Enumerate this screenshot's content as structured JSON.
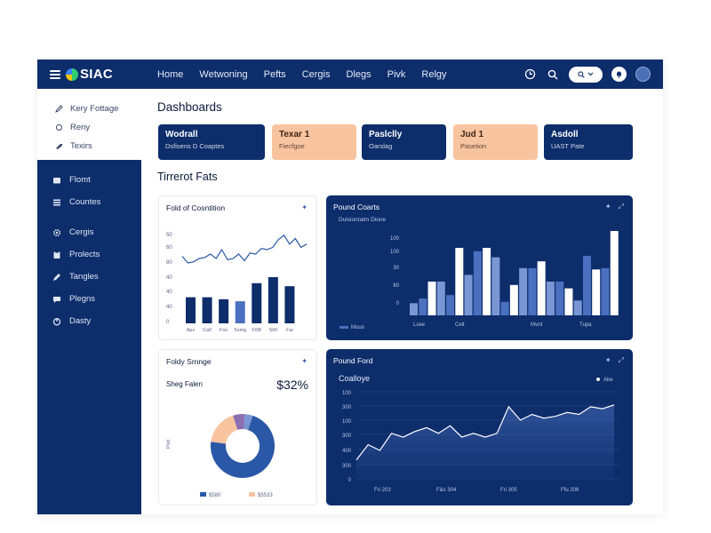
{
  "app": {
    "logo": "SIAC"
  },
  "nav": [
    "Home",
    "Wetwoning",
    "Pefts",
    "Cergis",
    "Dlegs",
    "Pivk",
    "Relgy"
  ],
  "sidebar": {
    "top_items": [
      "Kery Fottage",
      "Reny",
      "Texirs"
    ],
    "group1": [
      "Flomt",
      "Countes"
    ],
    "group2": [
      "Cergis",
      "Prolects",
      "Tangles",
      "Plegns",
      "Dasty"
    ]
  },
  "page": {
    "title": "Dashboards",
    "section_title": "Tirrerot Fats"
  },
  "kpis": [
    {
      "title": "Wodrall",
      "sub": "Dsfisens D Coaptes",
      "style": "dark"
    },
    {
      "title": "Texar 1",
      "sub": "Fiecfgoe",
      "style": "peach"
    },
    {
      "title": "Paslclly",
      "sub": "Oarslag",
      "style": "dark"
    },
    {
      "title": "Jud 1",
      "sub": "Pasetion",
      "style": "peach"
    },
    {
      "title": "Asdoll",
      "sub": "UAST Pate",
      "style": "dark"
    }
  ],
  "cards": {
    "fold": {
      "title": "Fold of Cosntition"
    },
    "pound": {
      "title": "Pound Coarts",
      "sub": "Duisiontatm Dione",
      "legend": "Mouo"
    },
    "fold2": {
      "title": "Foldy Srnnge",
      "summary_label": "Sheg Falen",
      "summary_value": "$32%",
      "axis_label": "Pivd",
      "legend": [
        "$580",
        "$5533"
      ]
    },
    "pound2": {
      "title": "Pound Ford",
      "subtitle": "Coalloye",
      "legend": "Abe"
    }
  },
  "colors": {
    "navy": "#0d2d6b",
    "accent_blue": "#2b58a6",
    "mid_blue": "#4a70bf",
    "light_blue": "#7a96d4",
    "peach": "#f8c4a0",
    "purple": "#8b6fb0"
  },
  "chart_data": [
    {
      "type": "line",
      "title": "Fold of Cosntition",
      "yticks": [
        "50",
        "60",
        "80",
        "40",
        "40",
        "40",
        "0"
      ],
      "x": [
        1,
        2,
        3,
        4,
        5,
        6,
        7,
        8,
        9,
        10,
        11,
        12,
        13,
        14,
        15,
        16,
        17,
        18,
        19,
        20,
        21,
        22,
        23
      ],
      "values": [
        50,
        44,
        45,
        48,
        49,
        52,
        48,
        56,
        47,
        48,
        52,
        46,
        53,
        52,
        57,
        56,
        58,
        65,
        69,
        61,
        66,
        58,
        61
      ],
      "ylim": [
        0,
        80
      ]
    },
    {
      "type": "bar",
      "categories": [
        "Apx",
        "Ca0",
        "Fxo",
        "Ssmg",
        "Fi98",
        "Slt0",
        "Fai"
      ],
      "values": [
        26,
        26,
        24,
        22,
        40,
        46,
        37
      ],
      "highlight_series": [
        0,
        0,
        0,
        22,
        0,
        0,
        0
      ],
      "ylim": [
        0,
        80
      ]
    },
    {
      "type": "bar",
      "title": "Pound Coarts",
      "yticks": [
        "100",
        "100",
        "30",
        "80",
        "0"
      ],
      "categories": [
        "Lsee",
        "Celt",
        "Mvrd",
        "Tupa"
      ],
      "series": [
        {
          "values": [
            18,
            50,
            60,
            86,
            70,
            50,
            22
          ]
        },
        {
          "values": [
            25,
            30,
            95,
            20,
            70,
            50,
            88,
            70
          ]
        },
        {
          "values": [
            50,
            100,
            100,
            45,
            80,
            40,
            68,
            125
          ]
        }
      ],
      "ylim": [
        0,
        140
      ]
    },
    {
      "type": "pie",
      "title": "Foldy Srnnge",
      "slices": [
        {
          "label": "$580",
          "value": 72
        },
        {
          "label": "$5533",
          "value": 18
        },
        {
          "value": 6
        },
        {
          "value": 4
        }
      ]
    },
    {
      "type": "area",
      "title": "Pound Ford",
      "yticks": [
        "100",
        "300",
        "100",
        "300",
        "400",
        "300",
        "0"
      ],
      "xticks": [
        "Fri 203",
        "F&s 304",
        "Fri 305",
        "Ffu 206"
      ],
      "x": [
        1,
        2,
        3,
        4,
        5,
        6,
        7,
        8,
        9,
        10,
        11,
        12,
        13,
        14,
        15,
        16,
        17,
        18,
        19,
        20,
        21,
        22,
        23
      ],
      "values": [
        100,
        180,
        150,
        240,
        220,
        250,
        270,
        240,
        280,
        220,
        240,
        220,
        240,
        380,
        310,
        340,
        320,
        330,
        350,
        340,
        380,
        370,
        390
      ],
      "ylim": [
        0,
        450
      ]
    }
  ]
}
